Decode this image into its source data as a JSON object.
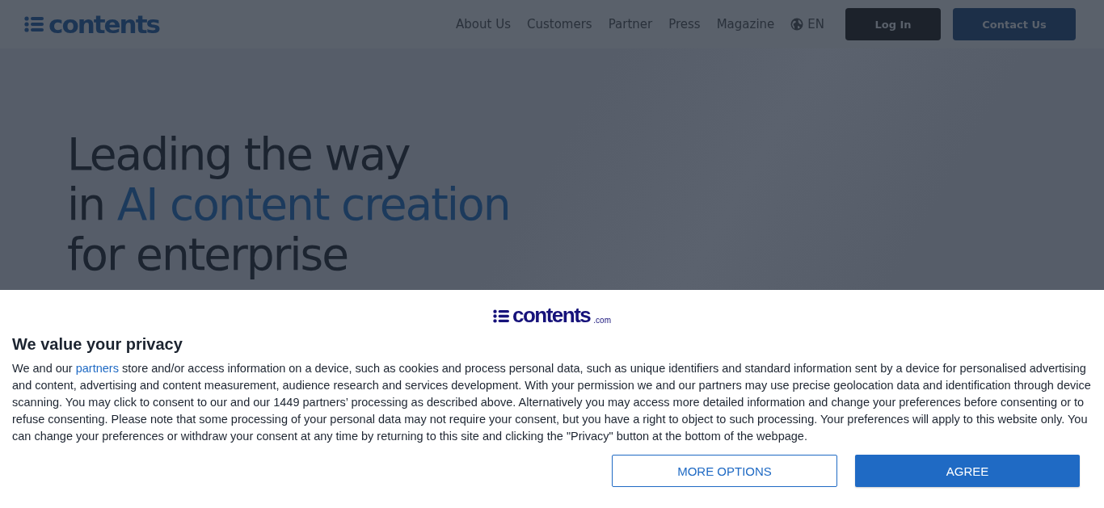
{
  "header": {
    "logo": "contents",
    "nav": [
      "About Us",
      "Customers",
      "Partner",
      "Press",
      "Magazine"
    ],
    "language": "EN",
    "login": "Log In",
    "contact": "Contact Us"
  },
  "hero": {
    "lines": [
      {
        "plain": "Leading the way"
      },
      {
        "plain": "in ",
        "accent": "AI content creation"
      },
      {
        "plain": "for enterprise"
      }
    ]
  },
  "consent": {
    "logo": "contents",
    "logo_suffix": ".com",
    "title": "We value your privacy",
    "text_before": "We and our ",
    "link": "partners",
    "text_after": " store and/or access information on a device, such as cookies and process personal data, such as unique identifiers and standard information sent by a device for personalised advertising and content, advertising and content measurement, audience research and services development. With your permission we and our partners may use precise geolocation data and identification through device scanning. You may click to consent to our and our 1449 partners’ processing as described above. Alternatively you may access more detailed information and change your preferences before consenting or to refuse consenting. Please note that some processing of your personal data may not require your consent, but you have a right to object to such processing. Your preferences will apply to this website only. You can change your preferences or withdraw your consent at any time by returning to this site and clicking the \"Privacy\" button at the bottom of the webpage.",
    "more": "MORE OPTIONS",
    "agree": "AGREE"
  }
}
